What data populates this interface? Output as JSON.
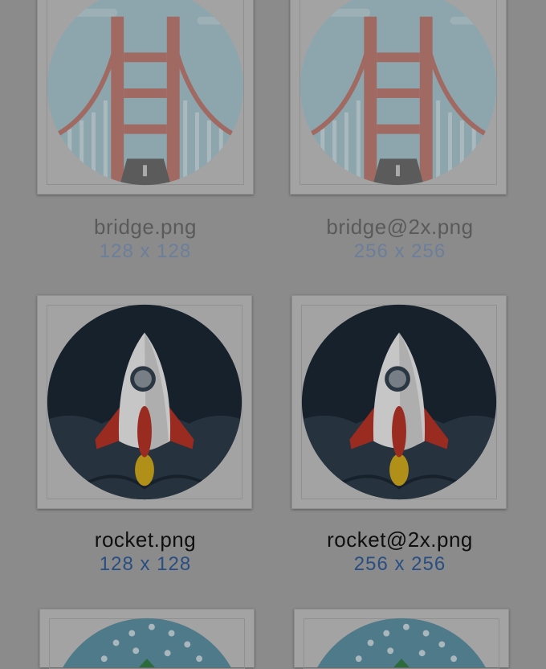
{
  "assets": [
    {
      "file": "bridge.png",
      "size": "128 x 128",
      "art": "bridge-icon"
    },
    {
      "file": "bridge@2x.png",
      "size": "256 x 256",
      "art": "bridge-icon"
    },
    {
      "file": "rocket.png",
      "size": "128 x 128",
      "art": "rocket-icon"
    },
    {
      "file": "rocket@2x.png",
      "size": "256 x 256",
      "art": "rocket-icon"
    }
  ],
  "colors": {
    "background": "#8b8b8b",
    "dimmed_name": "#5a5a5a",
    "dimmed_size": "#6b7f9a",
    "highlight_name": "#0f0f0f",
    "highlight_size": "#284e82"
  }
}
